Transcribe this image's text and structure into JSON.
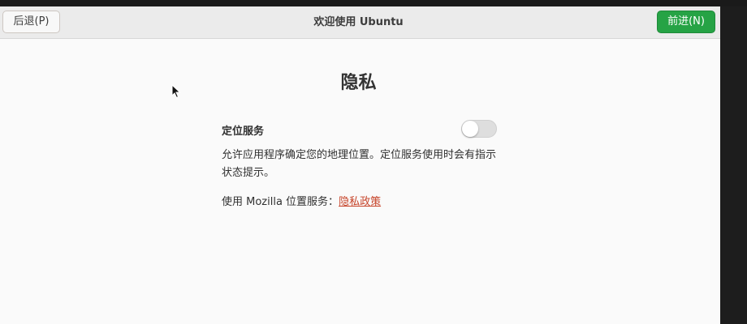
{
  "header": {
    "back_label": "后退(P)",
    "title": "欢迎使用 Ubuntu",
    "next_label": "前进(N)"
  },
  "page": {
    "title": "隐私",
    "location_services": {
      "label": "定位服务",
      "enabled": false,
      "description": "允许应用程序确定您的地理位置。定位服务使用时会有指示状态提示。",
      "mozilla_text": "使用 Mozilla 位置服务：",
      "privacy_link": "隐私政策"
    }
  },
  "colors": {
    "next_button": "#26a345",
    "link": "#c7452b",
    "window_bg": "#fafafa",
    "header_bg": "#ebebeb"
  },
  "icons": {
    "cursor": "mouse-pointer-icon"
  }
}
